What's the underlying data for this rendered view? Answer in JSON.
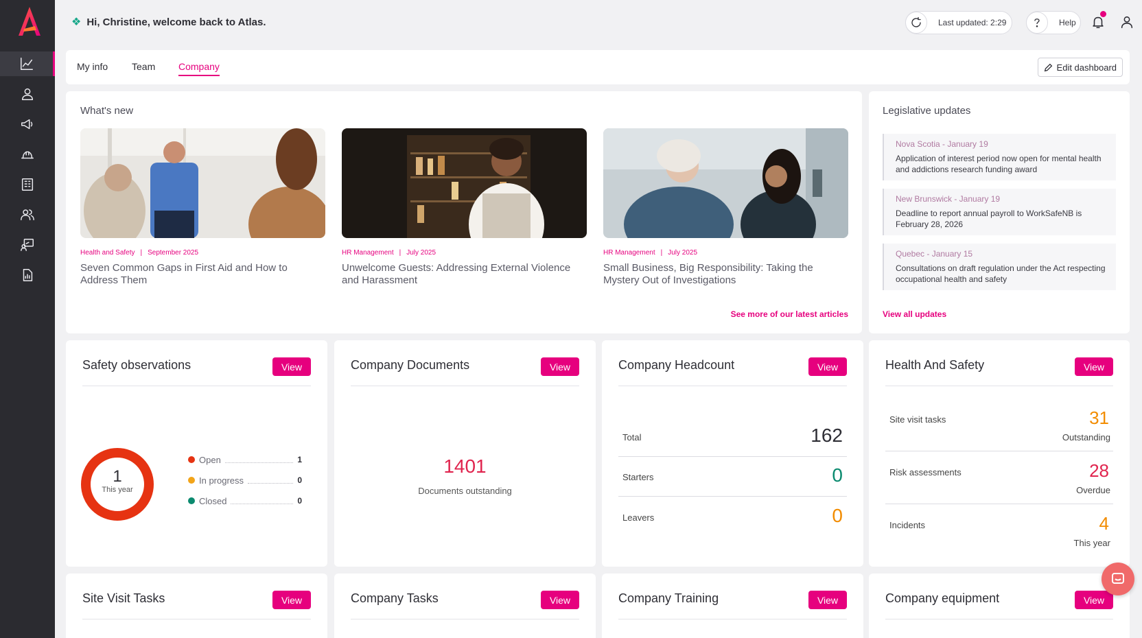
{
  "header": {
    "greeting": "Hi, Christine, welcome back to Atlas.",
    "last_updated": "Last updated: 2:29",
    "help": "Help"
  },
  "tabs": [
    {
      "label": "My info",
      "active": false
    },
    {
      "label": "Team",
      "active": false
    },
    {
      "label": "Company",
      "active": true
    }
  ],
  "edit_dashboard": "Edit dashboard",
  "whats_new": {
    "title": "What's new",
    "articles": [
      {
        "category": "Health and Safety",
        "date": "September 2025",
        "title": "Seven Common Gaps in First Aid and How to Address Them"
      },
      {
        "category": "HR Management",
        "date": "July 2025",
        "title": "Unwelcome Guests: Addressing External Violence and Harassment"
      },
      {
        "category": "HR Management",
        "date": "July 2025",
        "title": "Small Business, Big Responsibility: Taking the Mystery Out of Investigations"
      }
    ],
    "more_link": "See more of our latest articles"
  },
  "legislative": {
    "title": "Legislative updates",
    "items": [
      {
        "region": "Nova Scotia - January 19",
        "text": "Application of interest period now open for mental health and addictions research funding award"
      },
      {
        "region": "New Brunswick - January 19",
        "text": "Deadline to report annual payroll to WorkSafeNB is February 28, 2026"
      },
      {
        "region": "Quebec - January 15",
        "text": "Consultations on draft regulation under the Act respecting occupational health and safety"
      }
    ],
    "view_all": "View all updates"
  },
  "view_label": "View",
  "safety": {
    "title": "Safety observations",
    "total": "1",
    "total_label": "This year",
    "legend": [
      {
        "label": "Open",
        "value": "1",
        "color": "#e63312"
      },
      {
        "label": "In progress",
        "value": "0",
        "color": "#f2a419"
      },
      {
        "label": "Closed",
        "value": "0",
        "color": "#0b8a6f"
      }
    ]
  },
  "documents": {
    "title": "Company Documents",
    "count": "1401",
    "label": "Documents outstanding"
  },
  "headcount": {
    "title": "Company Headcount",
    "rows": [
      {
        "label": "Total",
        "value": "162",
        "color": "#2e2e35"
      },
      {
        "label": "Starters",
        "value": "0",
        "color": "#0b8a6f"
      },
      {
        "label": "Leavers",
        "value": "0",
        "color": "#f28c00"
      }
    ]
  },
  "health_safety": {
    "title": "Health And Safety",
    "rows": [
      {
        "label": "Site visit tasks",
        "value": "31",
        "sub": "Outstanding",
        "color": "#f28c00"
      },
      {
        "label": "Risk assessments",
        "value": "28",
        "sub": "Overdue",
        "color": "#e0244e"
      },
      {
        "label": "Incidents",
        "value": "4",
        "sub": "This year",
        "color": "#f28c00"
      }
    ]
  },
  "bottom_widgets": [
    {
      "title": "Site Visit Tasks"
    },
    {
      "title": "Company Tasks"
    },
    {
      "title": "Company Training"
    },
    {
      "title": "Company equipment"
    }
  ],
  "colors": {
    "accent": "#e6007e",
    "sidebar": "#2b2b30"
  }
}
